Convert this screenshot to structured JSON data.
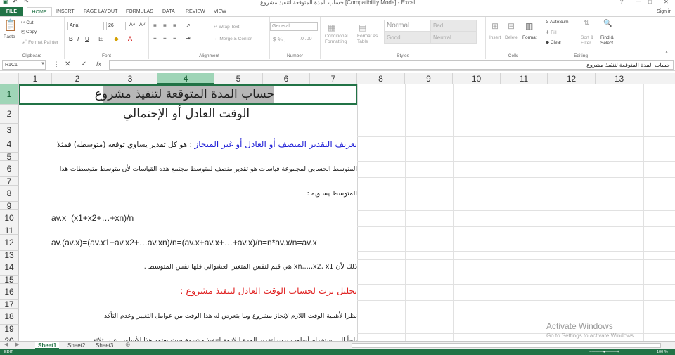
{
  "window": {
    "title": "حساب المدة المتوقعة لتنفيذ مشروع [Compatibility Mode] - Excel",
    "sign_in": "Sign in"
  },
  "tabs": [
    "FILE",
    "HOME",
    "INSERT",
    "PAGE LAYOUT",
    "FORMULAS",
    "DATA",
    "REVIEW",
    "VIEW"
  ],
  "ribbon": {
    "clipboard": {
      "label": "Clipboard",
      "paste": "Paste",
      "cut": "Cut",
      "copy": "Copy",
      "format_painter": "Format Painter"
    },
    "font": {
      "label": "Font",
      "name": "Arial",
      "size": "26",
      "bold": "B",
      "italic": "I",
      "underline": "U"
    },
    "alignment": {
      "label": "Alignment",
      "wrap": "Wrap Text",
      "merge": "Merge & Center"
    },
    "number": {
      "label": "Number",
      "format": "General"
    },
    "styles": {
      "label": "Styles",
      "cond": "Conditional Formatting",
      "table": "Format as Table",
      "normal": "Normal",
      "bad": "Bad",
      "good": "Good",
      "neutral": "Neutral"
    },
    "cells": {
      "label": "Cells",
      "insert": "Insert",
      "delete": "Delete",
      "format": "Format"
    },
    "editing": {
      "label": "Editing",
      "autosum": "AutoSum",
      "fill": "Fill",
      "clear": "Clear",
      "sort": "Sort & Filter",
      "find": "Find & Select"
    }
  },
  "formula_bar": {
    "name_box": "R1C1",
    "fx": "fx",
    "content": "حساب المدة المتوقعة لتنفيذ مشروع"
  },
  "columns": [
    "1",
    "2",
    "3",
    "4",
    "5",
    "6",
    "7",
    "8",
    "9",
    "10",
    "11",
    "12",
    "13"
  ],
  "rows": [
    "1",
    "2",
    "3",
    "4",
    "5",
    "6",
    "7",
    "8",
    "9",
    "10",
    "11",
    "12",
    "13",
    "14",
    "15",
    "16",
    "17",
    "18",
    "19",
    "20"
  ],
  "cells": {
    "r1": "حساب المدة المتوقعة لتنفيذ مشروع",
    "r2": "الوقت العادل أو الإحتمالي",
    "r4a": "تعريف التقدير المنصف أو العادل أو غير المنحاز",
    "r4b": " : هو كل تقدير يساوي توقعه (متوسطه) فمثلا",
    "r6": "المتوسط الحسابي لمجموعة قياسات هو تقدير منصف لمتوسط مجتمع هذه القياسات لأن متوسط متوسطات هذا",
    "r8": "المتوسط يساويه :",
    "r10": "av.x=(x1+x2+…+xn)/n",
    "r12": "av.(av.x)=(av.x1+av.x2+…av.xn)/n=(av.x+av.x+…+av.x)/n=n*av.x/n=av.x",
    "r14": "ذلك لأن xn,…,x2, x1 هي قيم لنفس المتغير العشوائي فلها نفس المتوسط .",
    "r16": "تحليل برت لحساب الوقت العادل لتنفيذ مشروع :",
    "r18": "نظرا لأهمية الوقت اللازم لإنجاز مشروع وما يتعرض له هذا الوقت من عوامل التغيير وعدم التأكد",
    "r20": "يلجأ إلى استخدام أسلوب برت لتقدير المدة اللازمة لتنفيذ مشروع حيث يعتمد هذا الأسلوب على ثلاثة"
  },
  "sheets": [
    "Sheet1",
    "Sheet2",
    "Sheet3"
  ],
  "activate": {
    "title": "Activate Windows",
    "sub": "Go to Settings to activate Windows."
  },
  "status": {
    "mode": "EDIT",
    "zoom": "100 %"
  },
  "colors": {
    "accent": "#217346",
    "blue": "#1f1fd6",
    "red": "#e02020"
  }
}
